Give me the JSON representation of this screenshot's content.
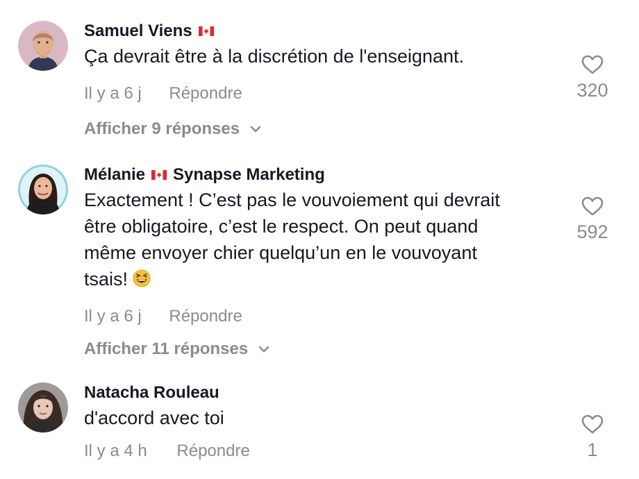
{
  "comments": [
    {
      "author": "Samuel Viens",
      "author_flag": "canada-flag-icon",
      "author_extra": "",
      "text": "Ça devrait être à la discrétion de l'enseignant.",
      "time": "Il y a 6 j",
      "reply_label": "Répondre",
      "replies_label": "Afficher 9 réponses",
      "likes": "320"
    },
    {
      "author": "Mélanie",
      "author_flag": "canada-flag-icon",
      "author_extra": "Synapse Marketing",
      "text_lines": [
        "Exactement ! C’est pas le vouvoiement qui devrait",
        "être obligatoire, c’est le respect. On peut quand",
        "même envoyer chier quelqu’un en le vouvoyant",
        "tsais!"
      ],
      "emoji": "rolling-laughing-emoji",
      "time": "Il y a 6 j",
      "reply_label": "Répondre",
      "replies_label": "Afficher 11 réponses",
      "likes": "592"
    },
    {
      "author": "Natacha Rouleau",
      "text": "d'accord avec toi",
      "time": "Il y a 4 h",
      "reply_label": "Répondre",
      "likes": "1"
    }
  ],
  "colors": {
    "primary_text": "#161823",
    "secondary_text": "#8a8b91",
    "flag_red": "#e1282d"
  }
}
